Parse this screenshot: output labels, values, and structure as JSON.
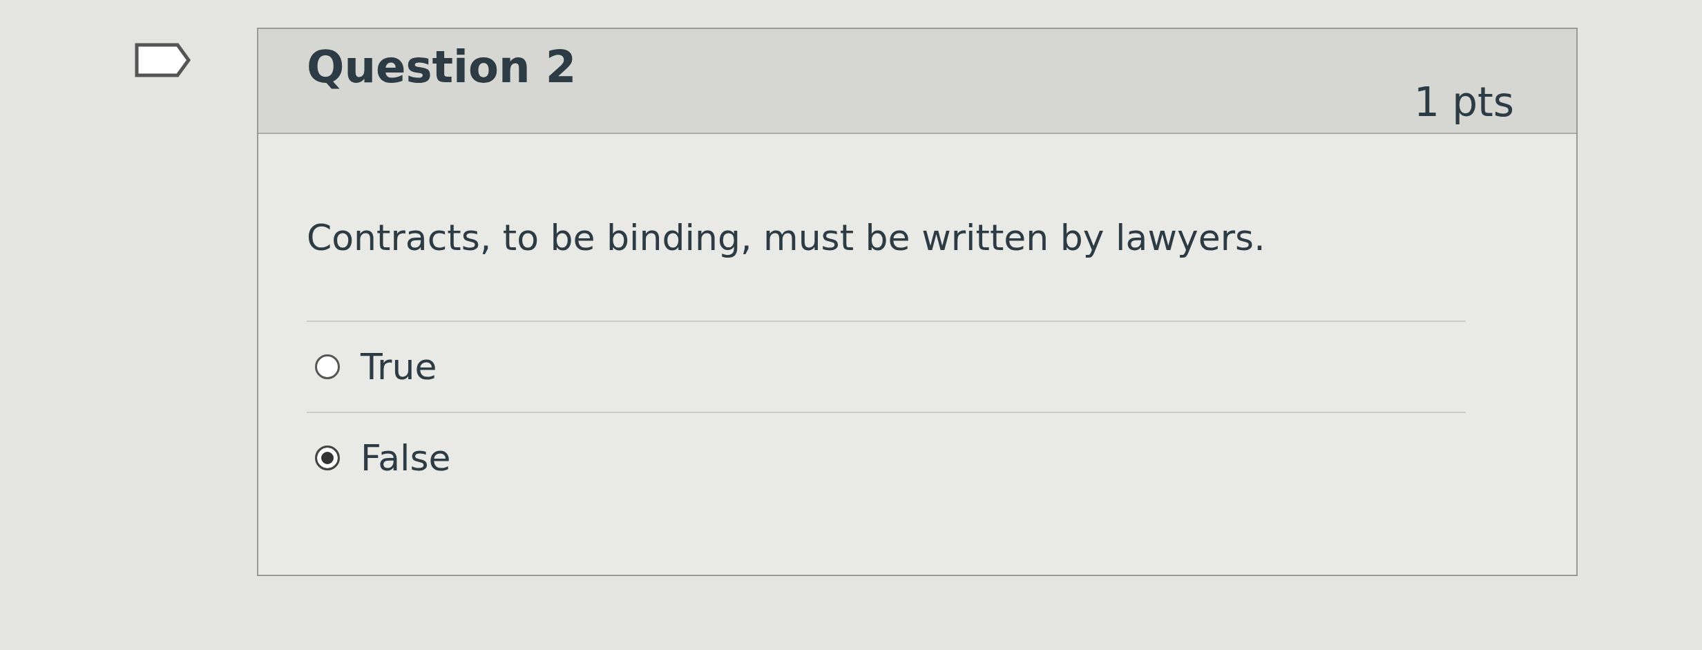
{
  "question": {
    "title": "Question 2",
    "points": "1 pts",
    "text": "Contracts, to be binding, must be written by lawyers.",
    "answers": [
      {
        "label": "True",
        "selected": false
      },
      {
        "label": "False",
        "selected": true
      }
    ]
  }
}
